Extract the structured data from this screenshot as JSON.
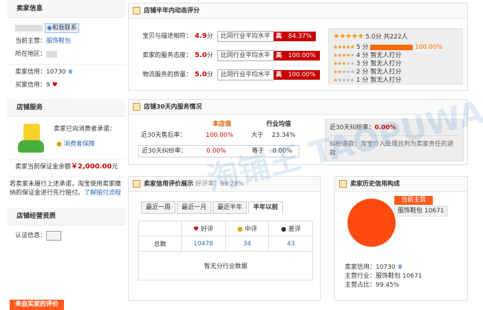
{
  "seller_info": {
    "title": "卖家信息",
    "contact": "和我联系",
    "main_category_label": "当前主营：",
    "main_category": "服饰鞋包",
    "region_label": "所在地区：",
    "seller_credit_label": "卖家信用：",
    "seller_credit": "10730",
    "buyer_credit_label": "买家信用：",
    "buyer_credit": "9"
  },
  "shop_service": {
    "title": "店铺服务",
    "promise": "卖家已向消费者承诺：",
    "guarantee": "消费者保障",
    "deposit_label": "卖家当前保证金余额",
    "deposit": "￥2,000.00",
    "deposit_unit": "元",
    "note": "若卖家未履行上述承诺，淘宝使用卖家缴纳的保证金进行先行赔付。",
    "note_link": "了解赔付流程"
  },
  "qualification": {
    "title": "店铺经营资质",
    "cert_label": "认证信息："
  },
  "bottom_tab": "来自买家的评价",
  "dynamic_rating": {
    "title": "店铺半年内动态评分",
    "rows": [
      {
        "label": "宝贝与描述相符：",
        "score": "4.9",
        "unit": "分",
        "compare": "比同行业平均水平",
        "level": "高",
        "pct": "84.37%"
      },
      {
        "label": "卖家的服务态度：",
        "score": "5.0",
        "unit": "分",
        "compare": "比同行业平均水平",
        "level": "高",
        "pct": "100.00%"
      },
      {
        "label": "物流服务的质量：",
        "score": "5.0",
        "unit": "分",
        "compare": "比同行业平均水平",
        "level": "高",
        "pct": "100.00%"
      }
    ],
    "summary": "5.0分 共222人",
    "dist": [
      {
        "label": "5 分",
        "value": "100.00%"
      },
      {
        "label": "4 分",
        "value": "暂无人打分"
      },
      {
        "label": "3 分",
        "value": "暂无人打分"
      },
      {
        "label": "2 分",
        "value": "暂无人打分"
      },
      {
        "label": "1 分",
        "value": "暂无人打分"
      }
    ]
  },
  "service30": {
    "title": "店铺30天内服务情况",
    "col_shop": "本店值",
    "col_avg": "行业均值",
    "rows": [
      {
        "label": "近30天售后率：",
        "shop": "100.00%",
        "cmp": "大于",
        "avg": "23.34%"
      },
      {
        "label": "近30天纠纷率：",
        "shop": "0.00%",
        "cmp": "等于",
        "avg": "0.00%"
      }
    ],
    "dispute_label": "近30天纠纷率：",
    "dispute_value": "0.00%",
    "dispute_note": "纠纷退款：淘宝介入处理且判为卖家责任的退款"
  },
  "credit_display": {
    "title": "卖家信用评价展示",
    "good_rate_label": "好评率：",
    "good_rate": "99.28%",
    "tabs": [
      "最近一周",
      "最近一月",
      "最近半年",
      "半年以前"
    ],
    "cols": [
      "好评",
      "中评",
      "差评"
    ],
    "total_label": "总数",
    "values": [
      "10478",
      "34",
      "43"
    ],
    "empty": "暂无分行业数据"
  },
  "history": {
    "title": "卖家历史信用构成",
    "current_label": "当前主营",
    "category": "服饰鞋包",
    "count": "10671",
    "credit_label": "卖家信用：",
    "credit": "10730",
    "industry_label": "主营行业：",
    "industry": "服饰鞋包 10671",
    "share_label": "主营占比：",
    "share": "99.45%"
  },
  "watermark": "淘铺王 TAOPUWANG.COM",
  "colors": {
    "accent": "#c80000",
    "link": "#2f6bb5",
    "orange": "#ff5a1e"
  }
}
